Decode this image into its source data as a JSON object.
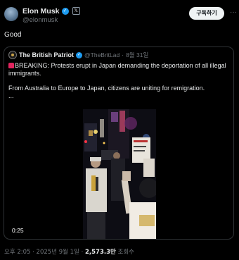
{
  "tweet": {
    "author_name": "Elon Musk",
    "author_handle": "@elonmusk",
    "subscribe_label": "구독하기",
    "more_label": "···",
    "text": "Good"
  },
  "quote": {
    "author_name": "The British Patriot",
    "author_handle": "@TheBritLad",
    "separator": "·",
    "date": "8월 31일",
    "line1": "BREAKING: Protests erupt in Japan demanding the deportation of all illegal immigrants.",
    "line2": "From Australia to Europe to Japan, citizens are uniting for remigration.",
    "line3": "...",
    "video_time": "0:25"
  },
  "meta": {
    "time": "오후 2:05",
    "separator": "·",
    "date": "2025년 9월 1일",
    "views_value": "2,573.3만",
    "views_label": "조회수"
  },
  "colors": {
    "accent": "#1d9bf0",
    "background": "#000000",
    "secondary_text": "#71767b",
    "siren": "#e0245e"
  }
}
